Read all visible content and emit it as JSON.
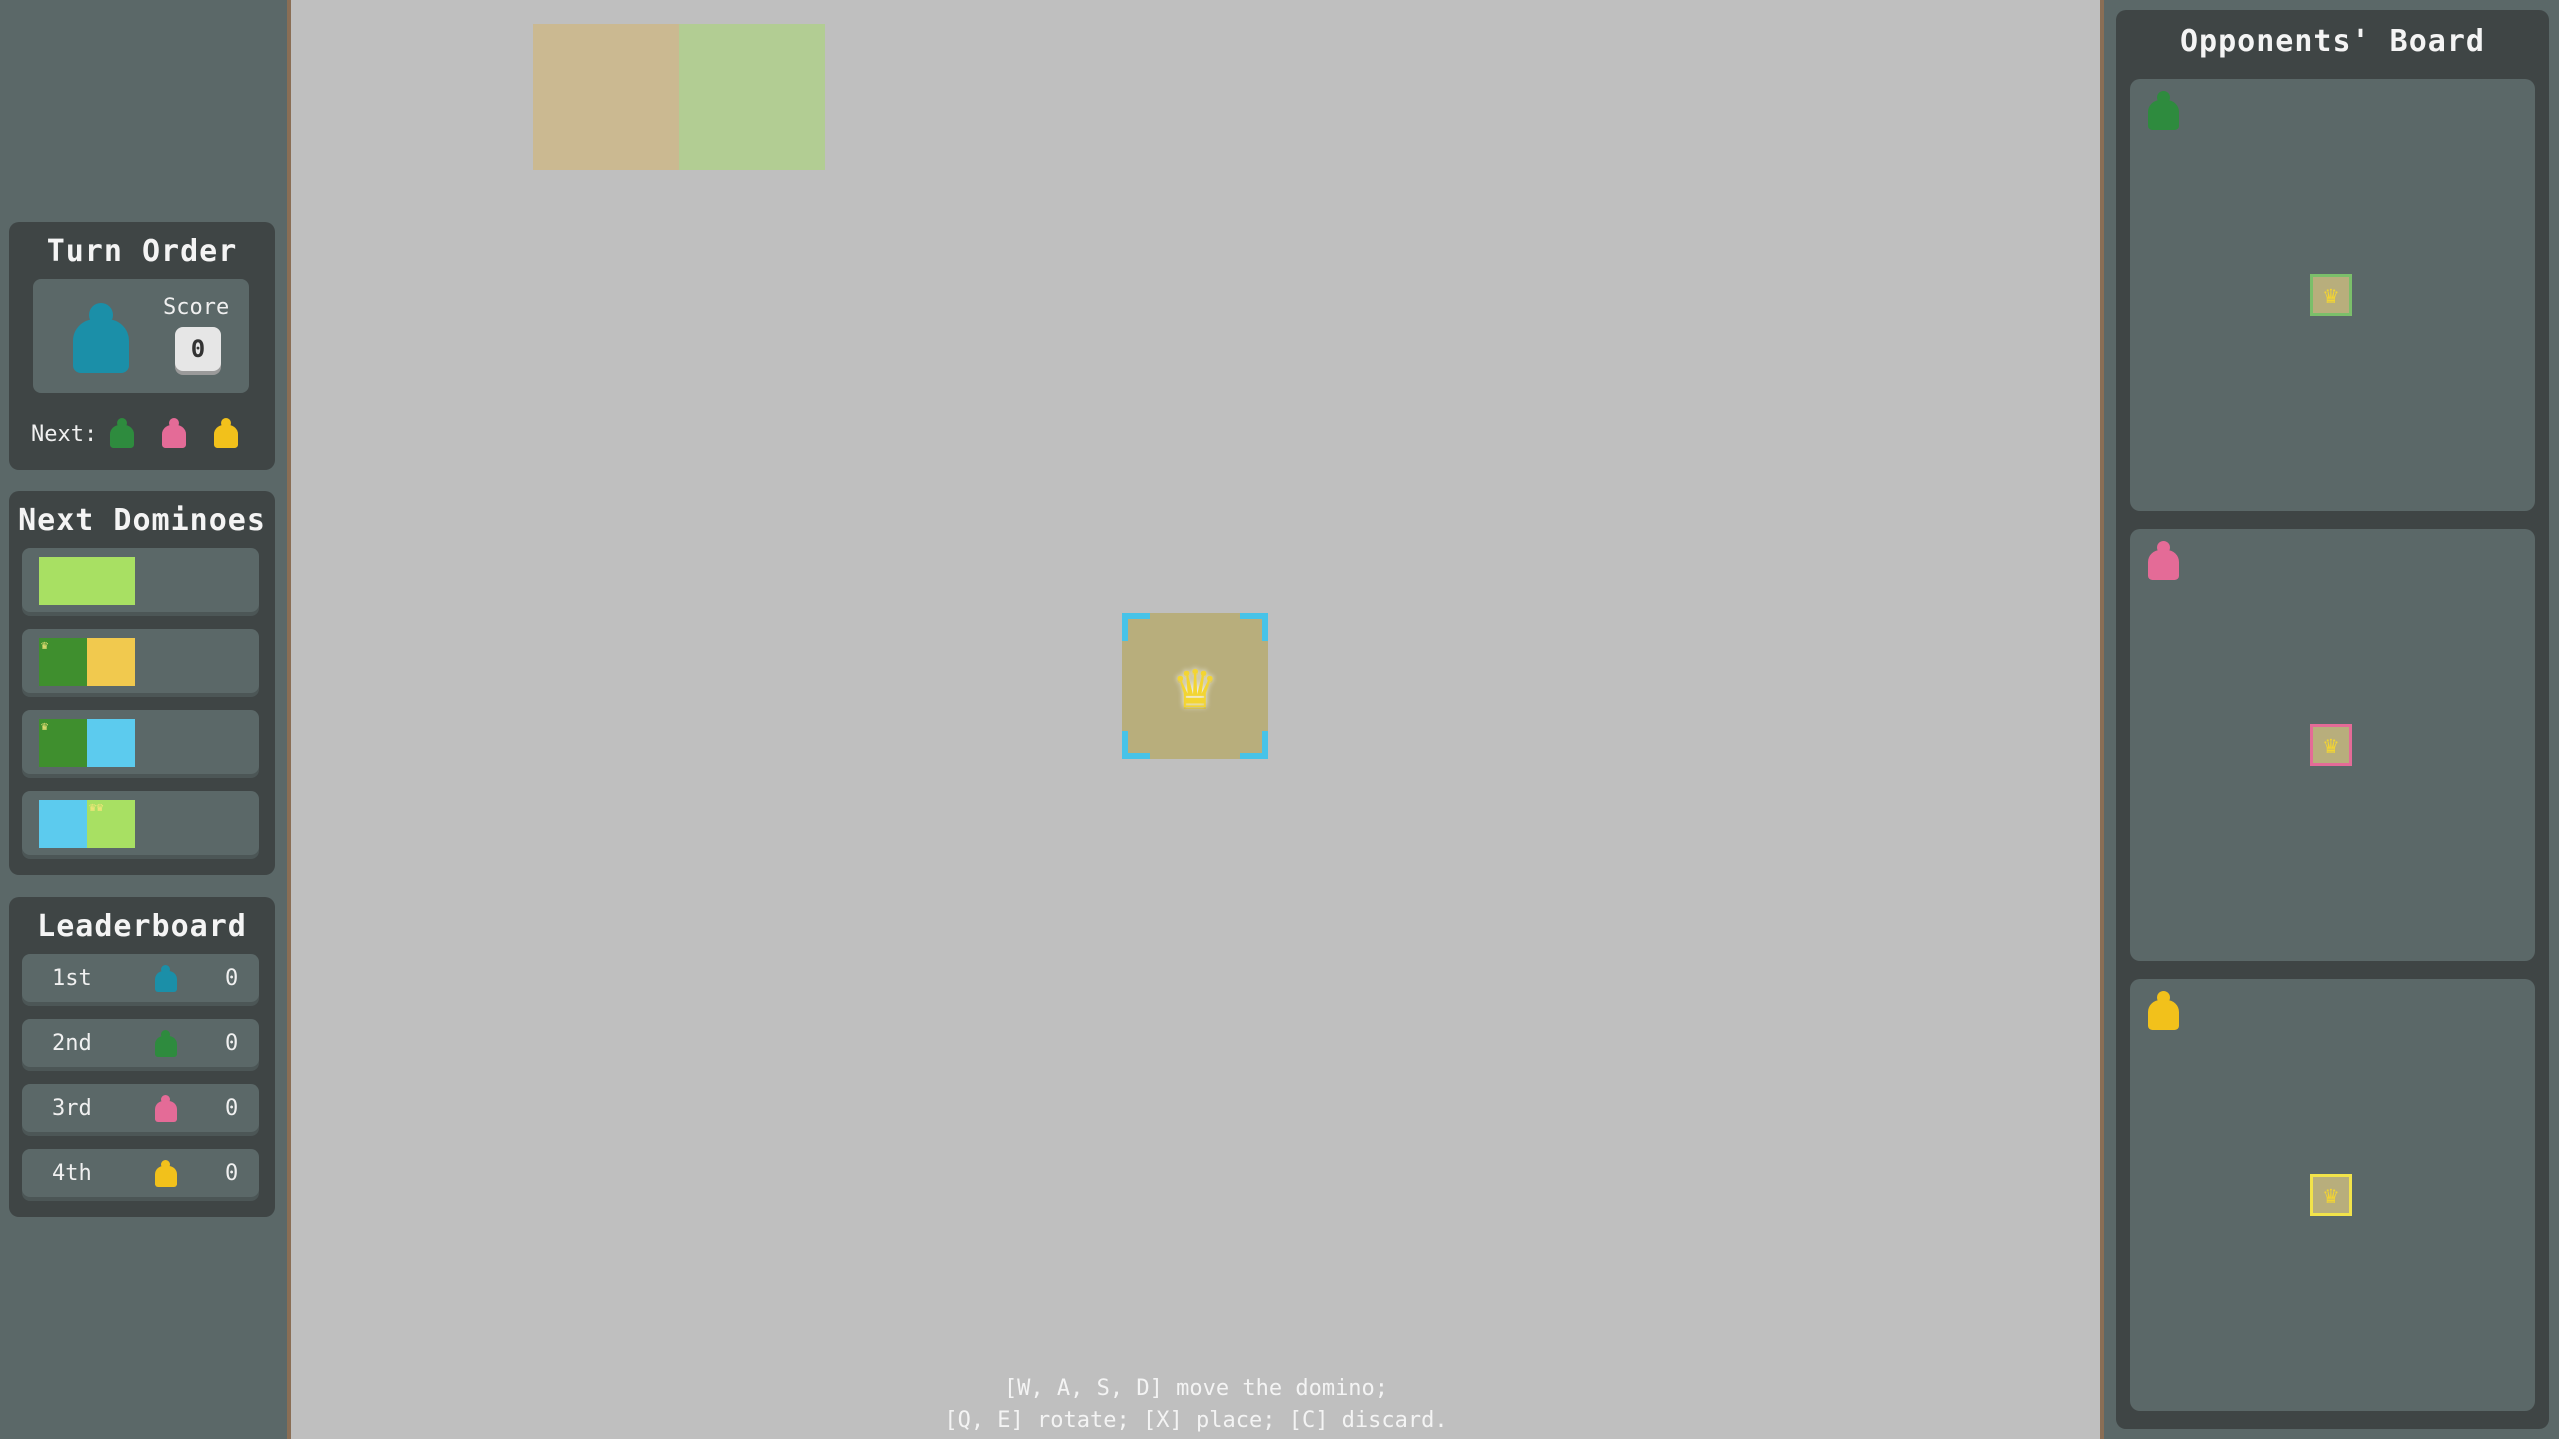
{
  "turn_order": {
    "title": "Turn Order",
    "current_player_color": "#1b8fa8",
    "score_label": "Score",
    "score_value": "0",
    "next_label": "Next:",
    "next_players": [
      {
        "color": "#2e8b3e",
        "icon": "green-meeple-icon"
      },
      {
        "color": "#e46b97",
        "icon": "pink-meeple-icon"
      },
      {
        "color": "#f2c11b",
        "icon": "yellow-meeple-icon"
      }
    ]
  },
  "next_dominoes": {
    "title": "Next Dominoes",
    "items": [
      {
        "left": "#a8e063",
        "right": "#a8e063",
        "left_crowns": 0,
        "right_crowns": 0
      },
      {
        "left": "#3f8f2e",
        "right": "#f1c94e",
        "left_crowns": 1,
        "right_crowns": 0
      },
      {
        "left": "#3f8f2e",
        "right": "#5ccbee",
        "left_crowns": 1,
        "right_crowns": 0
      },
      {
        "left": "#5ccbee",
        "right": "#a8e063",
        "left_crowns": 0,
        "right_crowns": 2
      }
    ]
  },
  "leaderboard": {
    "title": "Leaderboard",
    "rows": [
      {
        "rank": "1st",
        "color": "#1b8fa8",
        "score": "0"
      },
      {
        "rank": "2nd",
        "color": "#2e8b3e",
        "score": "0"
      },
      {
        "rank": "3rd",
        "color": "#e46b97",
        "score": "0"
      },
      {
        "rank": "4th",
        "color": "#f2c11b",
        "score": "0"
      }
    ]
  },
  "board": {
    "held_domino": {
      "left": "#d6b56b",
      "right": "#a8d870"
    },
    "castle_icon": "crown-icon",
    "selection_color": "#47c3e8",
    "help_line1": "[W, A, S, D] move the domino;",
    "help_line2": "[Q, E] rotate; [X] place; [C] discard."
  },
  "opponents": {
    "title": "Opponents' Board",
    "boards": [
      {
        "color": "#2e8b3e",
        "castle_border": "#7bbf6a"
      },
      {
        "color": "#e46b97",
        "castle_border": "#e46b97"
      },
      {
        "color": "#f2c11b",
        "castle_border": "#f2e34a"
      }
    ]
  }
}
